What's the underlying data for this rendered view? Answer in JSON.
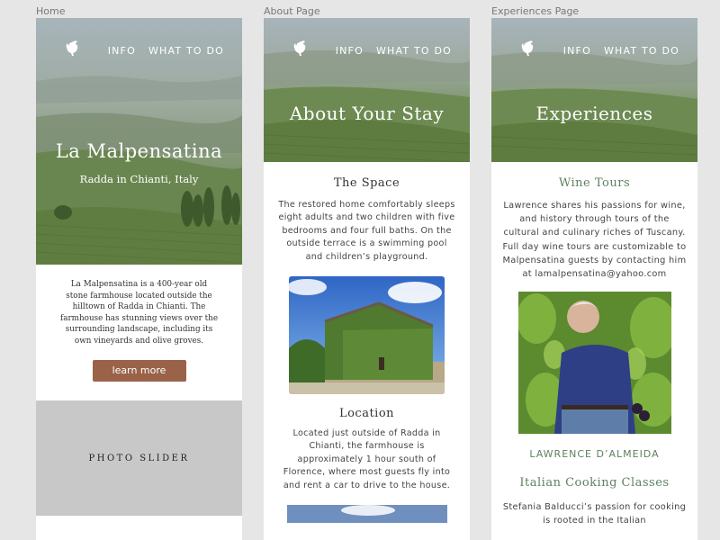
{
  "frames": {
    "home": {
      "label": "Home",
      "nav": {
        "info": "INFO",
        "what_to_do": "WHAT TO DO"
      },
      "title": "La Malpensatina",
      "subtitle": "Radda in Chianti, Italy",
      "body": "La Malpensatina is a 400-year old stone farmhouse located outside the hilltown of Radda in Chianti. The farmhouse has stunning views over the surrounding landscape, including its own vineyards and olive groves.",
      "button": "learn more",
      "slider": "PHOTO SLIDER"
    },
    "about": {
      "label": "About Page",
      "nav": {
        "info": "INFO",
        "what_to_do": "WHAT TO DO"
      },
      "title": "About Your Stay",
      "space_heading": "The Space",
      "space_text": "The restored home comfortably sleeps eight adults and two children with five bedrooms and four full baths. On the outside terrace is a swimming pool and children’s playground.",
      "location_heading": "Location",
      "location_text": "Located just outside of Radda in Chianti, the farmhouse is approximately 1 hour south of Florence, where most guests fly into and rent a car to drive to the house."
    },
    "experiences": {
      "label": "Experiences Page",
      "nav": {
        "info": "INFO",
        "what_to_do": "WHAT TO DO"
      },
      "title": "Experiences",
      "wine_heading": "Wine Tours",
      "wine_text": "Lawrence shares his passions for wine, and history through tours of the cultural and culinary riches of Tuscany. Full day wine tours are customizable to Malpensatina guests by contacting him at lamalpensatina@yahoo.com",
      "person_name": "LAWRENCE D’ALMEIDA",
      "cooking_heading": "Italian Cooking Classes",
      "cooking_text": "Stefania Balducci’s passion for cooking is rooted in the Italian"
    }
  },
  "colors": {
    "button": "#9a6249",
    "accent_green": "#5f8060",
    "slider_bg": "#c8c8c8",
    "canvas": "#e6e6e6"
  },
  "icons": [
    "rooster-logo-icon"
  ]
}
